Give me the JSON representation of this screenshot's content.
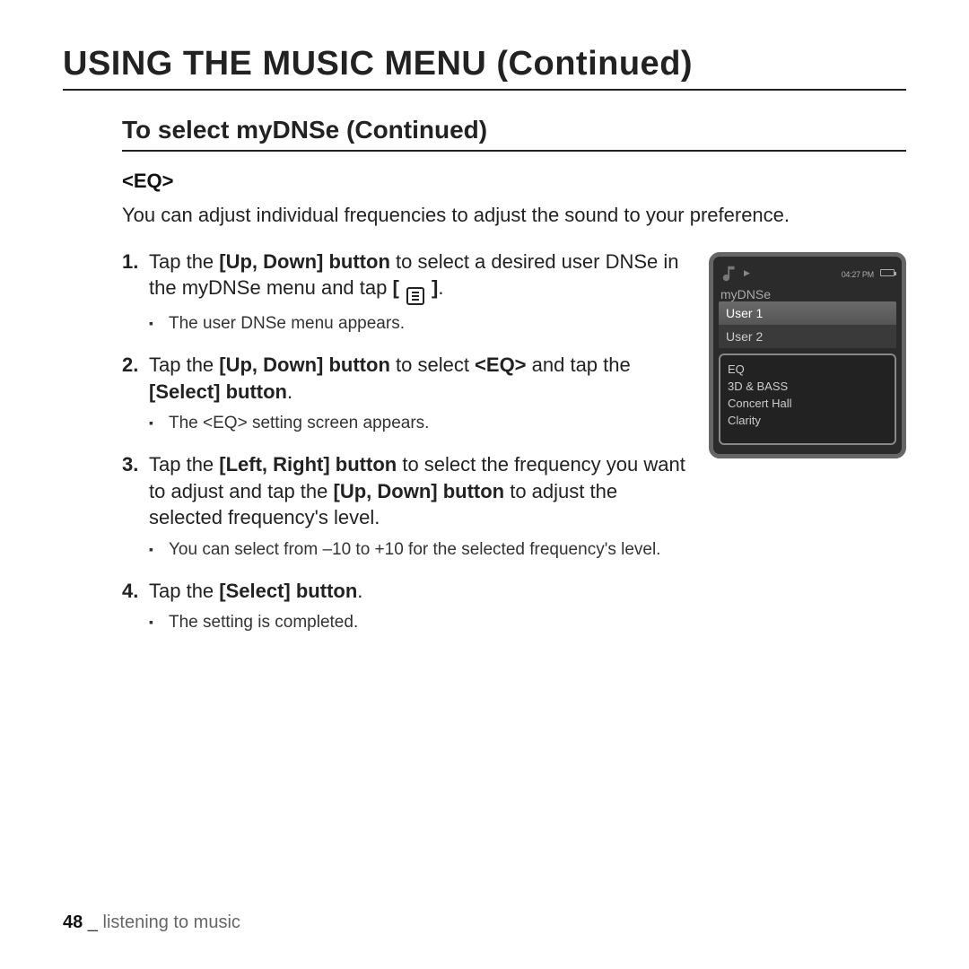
{
  "heading": "USING THE MUSIC MENU (Continued)",
  "subheading": "To select myDNSe (Continued)",
  "eq_label": "<EQ>",
  "intro": "You can adjust individual frequencies to adjust the sound to your preference.",
  "steps": {
    "s1_a": "Tap the ",
    "s1_b": "[Up, Down] button",
    "s1_c": " to select a desired user DNSe in the myDNSe menu and tap ",
    "s1_d": ".",
    "s1_sub": "The user DNSe menu appears.",
    "s2_a": "Tap the ",
    "s2_b": "[Up, Down] button",
    "s2_c": " to select ",
    "s2_d": "<EQ>",
    "s2_e": " and tap the ",
    "s2_f": "[Select] button",
    "s2_g": ".",
    "s2_sub": "The <EQ> setting screen appears.",
    "s3_a": "Tap the ",
    "s3_b": "[Left, Right] button",
    "s3_c": " to select the frequency you want to adjust and tap the ",
    "s3_d": "[Up, Down] button",
    "s3_e": " to adjust the selected frequency's level.",
    "s3_sub": "You can select from –10 to +10 for the selected frequency's level.",
    "s4_a": "Tap the ",
    "s4_b": "[Select] button",
    "s4_c": ".",
    "s4_sub": "The setting is completed."
  },
  "device": {
    "title": "myDNSe",
    "time": "04:27 PM",
    "rows": [
      "User 1",
      "User 2"
    ],
    "submenu": [
      "EQ",
      "3D & BASS",
      "Concert Hall",
      "Clarity"
    ]
  },
  "footer": {
    "page": "48",
    "sep": " _ ",
    "section": "listening to music"
  }
}
